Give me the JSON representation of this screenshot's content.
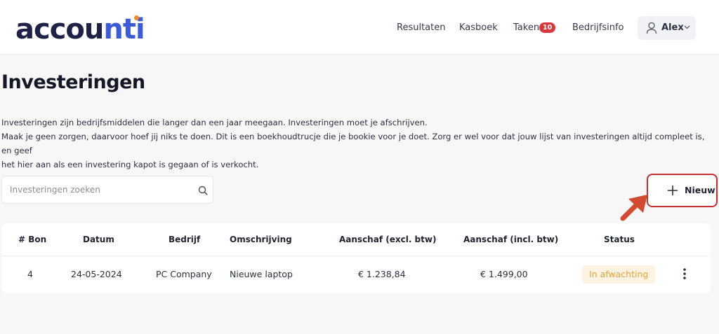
{
  "brand": {
    "logo_part1": "accou",
    "logo_part2": "nti",
    "colors": {
      "navy": "#1e2247",
      "blue": "#3b5bdb",
      "orange": "#f28a1d",
      "accent_red": "#c62e2e"
    }
  },
  "nav": {
    "items": [
      {
        "label": "Resultaten"
      },
      {
        "label": "Kasboek"
      },
      {
        "label": "Taken"
      },
      {
        "label": "Bedrijfsinfo"
      }
    ],
    "taken_badge": "10",
    "user": {
      "name": "Alex",
      "icon": "user-icon"
    }
  },
  "page": {
    "title": "Investeringen",
    "intro": [
      "Investeringen zijn bedrijfsmiddelen die langer dan een jaar meegaan. Investeringen moet je afschrijven.",
      "Maak je geen zorgen, daarvoor hoef jij niks te doen. Dit is een boekhoudtrucje die je bookie voor je doet. Zorg er wel voor dat jouw lijst van investeringen altijd compleet is, en geef",
      "het hier aan als een investering kapot is gegaan of is verkocht."
    ]
  },
  "search": {
    "placeholder": "Investeringen zoeken",
    "value": "",
    "icon": "search-icon"
  },
  "actions": {
    "new_label": "Nieuw",
    "icon": "plus-icon"
  },
  "table": {
    "columns": [
      "# Bon",
      "Datum",
      "Bedrijf",
      "Omschrijving",
      "Aanschaf (excl. btw)",
      "Aanschaf (incl. btw)",
      "Status"
    ],
    "rows": [
      {
        "bon": "4",
        "datum": "24-05-2024",
        "bedrijf": "PC Company",
        "omschrijving": "Nieuwe laptop",
        "excl": "€ 1.238,84",
        "incl": "€ 1.499,00",
        "status": "In afwachting"
      }
    ]
  }
}
